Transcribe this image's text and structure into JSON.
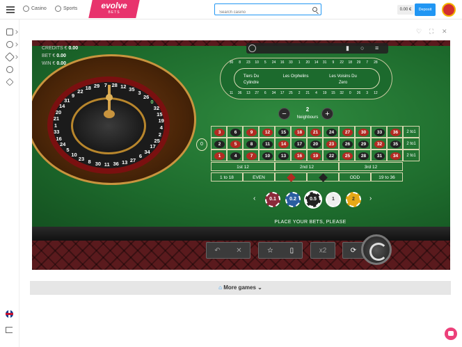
{
  "header": {
    "nav": [
      {
        "label": "Casino",
        "icon": "casino-icon"
      },
      {
        "label": "Sports",
        "icon": "sports-icon"
      }
    ],
    "logo": {
      "main": "evolve",
      "sub": "BETS"
    },
    "search_placeholder": "Search casino",
    "balance": "0.00 €",
    "deposit_label": "Deposit"
  },
  "sidebar": {
    "icons": [
      "casino-chip-icon",
      "settings-icon",
      "rocket-icon",
      "pacifier-icon",
      "diamond-icon"
    ],
    "bottom": [
      "uk-flag-icon",
      "logout-icon"
    ]
  },
  "game": {
    "hud": {
      "credits_label": "CREDITS €",
      "credits_value": "0.00",
      "bet_label": "BET €",
      "bet_value": "0.00",
      "win_label": "WIN €",
      "win_value": "0.00"
    },
    "wheel_numbers": [
      "21",
      "20",
      "14",
      "31",
      "9",
      "22",
      "18",
      "29",
      "7",
      "28",
      "12",
      "35",
      "3",
      "26",
      "0",
      "32",
      "15",
      "19",
      "4",
      "2",
      "25",
      "17",
      "34",
      "6",
      "27",
      "13",
      "36",
      "11",
      "30",
      "8",
      "23",
      "10",
      "5",
      "24",
      "16",
      "33",
      "1"
    ],
    "racetrack": {
      "sections": [
        "Tiers Du Cylindre",
        "Les Orphelins",
        "Les Voisins Du Zero"
      ],
      "top_numbers": [
        "30",
        "8",
        "23",
        "10",
        "5",
        "24",
        "16",
        "33",
        "1",
        "20",
        "14",
        "31",
        "9",
        "22",
        "18",
        "29",
        "7",
        "28"
      ],
      "bottom_numbers": [
        "11",
        "36",
        "13",
        "27",
        "6",
        "34",
        "17",
        "25",
        "2",
        "21",
        "4",
        "19",
        "15",
        "32",
        "0",
        "26",
        "3",
        "12"
      ]
    },
    "neighbours": {
      "value": "2",
      "label": "Neighbours",
      "minus": "−",
      "plus": "+"
    },
    "table": {
      "zero": "0",
      "rows": [
        [
          {
            "n": "3",
            "c": "red"
          },
          {
            "n": "6",
            "c": "blk"
          },
          {
            "n": "9",
            "c": "red"
          },
          {
            "n": "12",
            "c": "red"
          },
          {
            "n": "15",
            "c": "blk"
          },
          {
            "n": "18",
            "c": "red"
          },
          {
            "n": "21",
            "c": "red"
          },
          {
            "n": "24",
            "c": "blk"
          },
          {
            "n": "27",
            "c": "red"
          },
          {
            "n": "30",
            "c": "red"
          },
          {
            "n": "33",
            "c": "blk"
          },
          {
            "n": "36",
            "c": "red"
          }
        ],
        [
          {
            "n": "2",
            "c": "blk"
          },
          {
            "n": "5",
            "c": "red"
          },
          {
            "n": "8",
            "c": "blk"
          },
          {
            "n": "11",
            "c": "blk"
          },
          {
            "n": "14",
            "c": "red"
          },
          {
            "n": "17",
            "c": "blk"
          },
          {
            "n": "20",
            "c": "blk"
          },
          {
            "n": "23",
            "c": "red"
          },
          {
            "n": "26",
            "c": "blk"
          },
          {
            "n": "29",
            "c": "blk"
          },
          {
            "n": "32",
            "c": "red"
          },
          {
            "n": "35",
            "c": "blk"
          }
        ],
        [
          {
            "n": "1",
            "c": "red"
          },
          {
            "n": "4",
            "c": "blk"
          },
          {
            "n": "7",
            "c": "red"
          },
          {
            "n": "10",
            "c": "blk"
          },
          {
            "n": "13",
            "c": "blk"
          },
          {
            "n": "16",
            "c": "red"
          },
          {
            "n": "19",
            "c": "red"
          },
          {
            "n": "22",
            "c": "blk"
          },
          {
            "n": "25",
            "c": "red"
          },
          {
            "n": "28",
            "c": "blk"
          },
          {
            "n": "31",
            "c": "blk"
          },
          {
            "n": "34",
            "c": "red"
          }
        ]
      ],
      "columns": [
        "2 to1",
        "2 to1",
        "2 to1"
      ],
      "dozens": [
        "1st 12",
        "2nd 12",
        "3rd 12"
      ],
      "even_bets": [
        "1 to 18",
        "EVEN",
        "",
        "",
        "ODD",
        "19 to 36"
      ]
    },
    "chips": [
      {
        "label": "0.1",
        "color": "#8b2a3a"
      },
      {
        "label": "0.2",
        "color": "#2a5ea0"
      },
      {
        "label": "0.5",
        "color": "#222222"
      },
      {
        "label": "1",
        "color": "#eeeeee"
      },
      {
        "label": "2",
        "color": "#e6a817"
      }
    ],
    "status": "PLACE YOUR BETS, PLEASE",
    "controls": {
      "double": "x2"
    }
  },
  "more_games": "More games"
}
